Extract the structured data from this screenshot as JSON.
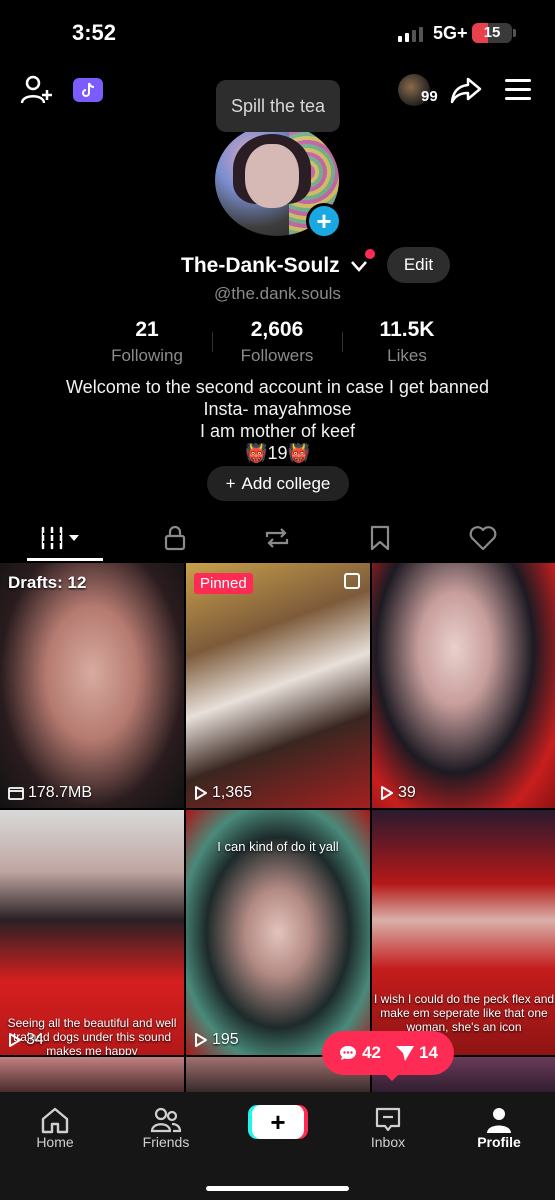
{
  "status": {
    "time": "3:52",
    "network": "5G+",
    "battery": "15"
  },
  "top_bar": {
    "story_count": "99",
    "tooltip": "Spill the tea"
  },
  "profile": {
    "name": "The-Dank-Soulz",
    "edit_label": "Edit",
    "handle": "@the.dank.souls",
    "stats": [
      {
        "value": "21",
        "label": "Following"
      },
      {
        "value": "2,606",
        "label": "Followers"
      },
      {
        "value": "11.5K",
        "label": "Likes"
      }
    ],
    "bio": [
      "Welcome to the second account in case I get banned",
      "Insta- mayahmose",
      "I am mother of keef",
      "👹19👹"
    ],
    "add_college": "Add college"
  },
  "grid": {
    "drafts_label": "Drafts: 12",
    "drafts_size": "178.7MB",
    "pinned_label": "Pinned",
    "videos": [
      {
        "views": "1,365"
      },
      {
        "views": "39"
      },
      {
        "views": "34",
        "caption": "Seeing all the beautiful and well trained dogs under this sound makes me happy"
      },
      {
        "views": "195",
        "caption": "I can kind of do it yall"
      },
      {
        "caption": "I wish I could do the peck flex and make em seperate like that one woman, she's an icon"
      }
    ]
  },
  "notifications": {
    "comments": "42",
    "mentions": "14"
  },
  "bottom_nav": {
    "home": "Home",
    "friends": "Friends",
    "inbox": "Inbox",
    "profile": "Profile"
  },
  "colors": {
    "accent": "#fe2c55",
    "plus_blue": "#1aa8e3",
    "cyan": "#25f4ee"
  }
}
